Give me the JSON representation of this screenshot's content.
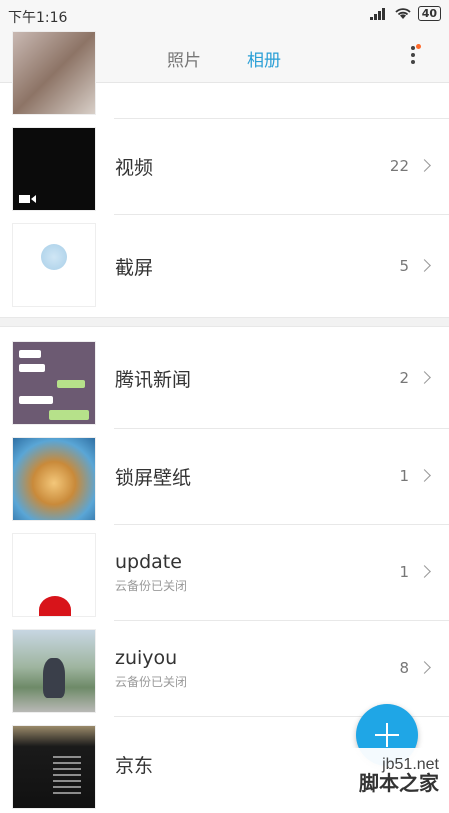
{
  "status_bar": {
    "time": "下午1:16",
    "battery": "40"
  },
  "tabs": {
    "photos": "照片",
    "albums": "相册"
  },
  "albums": [
    {
      "title": "视频",
      "count": "22"
    },
    {
      "title": "截屏",
      "count": "5"
    },
    {
      "title": "腾讯新闻",
      "count": "2"
    },
    {
      "title": "锁屏壁纸",
      "count": "1"
    },
    {
      "title": "update",
      "subtitle": "云备份已关闭",
      "count": "1"
    },
    {
      "title": "zuiyou",
      "subtitle": "云备份已关闭",
      "count": "8"
    },
    {
      "title": "京东"
    }
  ],
  "watermark": {
    "url": "jb51.net",
    "text": "脚本之家"
  },
  "colors": {
    "accent": "#2a9fd6",
    "fab": "#1fa6e6",
    "badge": "#ff6a2b"
  }
}
